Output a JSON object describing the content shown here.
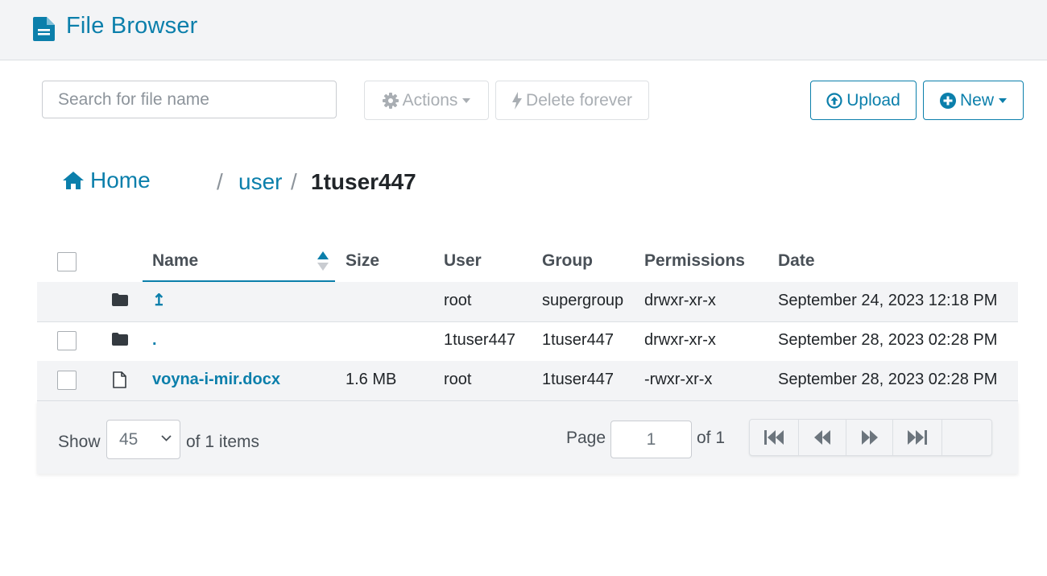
{
  "header": {
    "title": "File Browser",
    "icon": "file-text-icon"
  },
  "toolbar": {
    "search_placeholder": "Search for file name",
    "actions_label": "Actions",
    "delete_label": "Delete forever",
    "upload_label": "Upload",
    "new_label": "New"
  },
  "breadcrumb": {
    "home_label": "Home",
    "separator": "/",
    "user_label": "user",
    "current_label": "1tuser447"
  },
  "table": {
    "columns": [
      "Name",
      "Size",
      "User",
      "Group",
      "Permissions",
      "Date"
    ],
    "sorted_column": "Name",
    "rows": [
      {
        "type": "parent-folder",
        "name": "↥",
        "size": "",
        "user": "root",
        "group": "supergroup",
        "permissions": "drwxr-xr-x",
        "date": "September 24, 2023 12:18 PM",
        "has_checkbox": false
      },
      {
        "type": "folder",
        "name": ".",
        "size": "",
        "user": "1tuser447",
        "group": "1tuser447",
        "permissions": "drwxr-xr-x",
        "date": "September 28, 2023 02:28 PM",
        "has_checkbox": true
      },
      {
        "type": "file",
        "name": "voyna-i-mir.docx",
        "size": "1.6 MB",
        "user": "root",
        "group": "1tuser447",
        "permissions": "-rwxr-xr-x",
        "date": "September 28, 2023 02:28 PM",
        "has_checkbox": true
      }
    ]
  },
  "footer": {
    "show_label": "Show",
    "page_size": "45",
    "items_label": "of 1 items",
    "page_label": "Page",
    "page_value": "1",
    "of_pages_label": "of 1"
  },
  "colors": {
    "accent": "#0b7fab",
    "header_bg": "#f3f4f6",
    "disabled": "#a9aeb3"
  }
}
